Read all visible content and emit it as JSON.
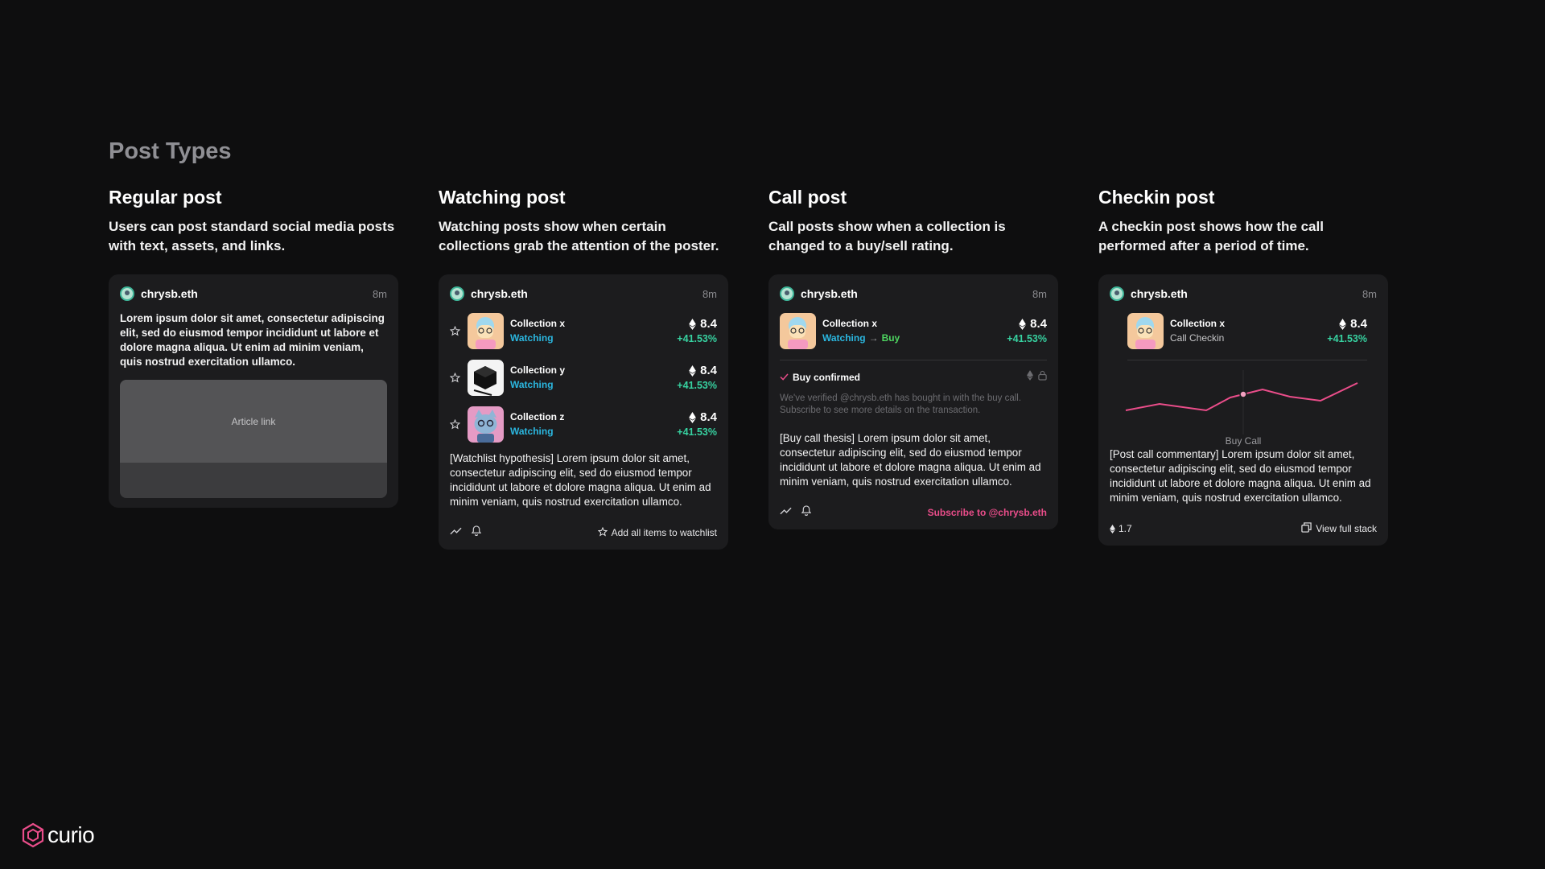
{
  "section_title": "Post Types",
  "colors": {
    "background": "#0e0e0f",
    "card": "#1c1c1e",
    "watching": "#2bb7e0",
    "buy": "#4ed661",
    "positive_change": "#37d2a1",
    "brand_pink": "#ea4d8a"
  },
  "columns": [
    {
      "heading": "Regular post",
      "description": "Users can post standard social media posts with text, assets, and links.",
      "card": {
        "username": "chrysb.eth",
        "time": "8m",
        "body": "Lorem ipsum dolor sit amet, consectetur adipiscing elit, sed do eiusmod tempor incididunt ut labore et dolore magna aliqua. Ut enim ad minim veniam, quis nostrud exercitation ullamco.",
        "article_link_label": "Article link"
      }
    },
    {
      "heading": "Watching post",
      "description": "Watching posts show when certain collections grab the attention of the poster.",
      "card": {
        "username": "chrysb.eth",
        "time": "8m",
        "collections": [
          {
            "name": "Collection x",
            "status": "Watching",
            "price": "8.4",
            "change": "+41.53%",
            "icon": "nft-cartoon-avatar"
          },
          {
            "name": "Collection y",
            "status": "Watching",
            "price": "8.4",
            "change": "+41.53%",
            "icon": "nft-black-cube"
          },
          {
            "name": "Collection z",
            "status": "Watching",
            "price": "8.4",
            "change": "+41.53%",
            "icon": "nft-cat-avatar"
          }
        ],
        "body": "[Watchlist hypothesis] Lorem ipsum dolor sit amet, consectetur adipiscing elit, sed do eiusmod tempor incididunt ut labore et dolore magna aliqua. Ut enim ad minim veniam, quis nostrud exercitation ullamco.",
        "footer_action": "Add all items to watchlist"
      }
    },
    {
      "heading": "Call post",
      "description": "Call posts show when a collection is changed to a buy/sell rating.",
      "card": {
        "username": "chrysb.eth",
        "time": "8m",
        "collection": {
          "name": "Collection x",
          "status_from": "Watching",
          "status_to": "Buy",
          "price": "8.4",
          "change": "+41.53%"
        },
        "confirm_label": "Buy confirmed",
        "verified_text": "We've verified @chrysb.eth has bought in with the buy call. Subscribe to see more details on the transaction.",
        "body": "[Buy call thesis] Lorem ipsum dolor sit amet, consectetur adipiscing elit, sed do eiusmod tempor incididunt ut labore et dolore magna aliqua. Ut enim ad minim veniam, quis nostrud exercitation ullamco.",
        "footer_action": "Subscribe to @chrysb.eth"
      }
    },
    {
      "heading": "Checkin post",
      "description": "A checkin post shows how the call performed after a period of time.",
      "card": {
        "username": "chrysb.eth",
        "time": "8m",
        "collection": {
          "name": "Collection x",
          "status": "Call Checkin",
          "price": "8.4",
          "change": "+41.53%"
        },
        "chart_label": "Buy Call",
        "body": "[Post call commentary] Lorem ipsum dolor sit amet, consectetur adipiscing elit, sed do eiusmod tempor incididunt ut labore et dolore magna aliqua. Ut enim ad minim veniam, quis nostrud exercitation ullamco.",
        "footer_value": "1.7",
        "footer_action": "View full stack"
      }
    }
  ],
  "logo_text": "curio"
}
